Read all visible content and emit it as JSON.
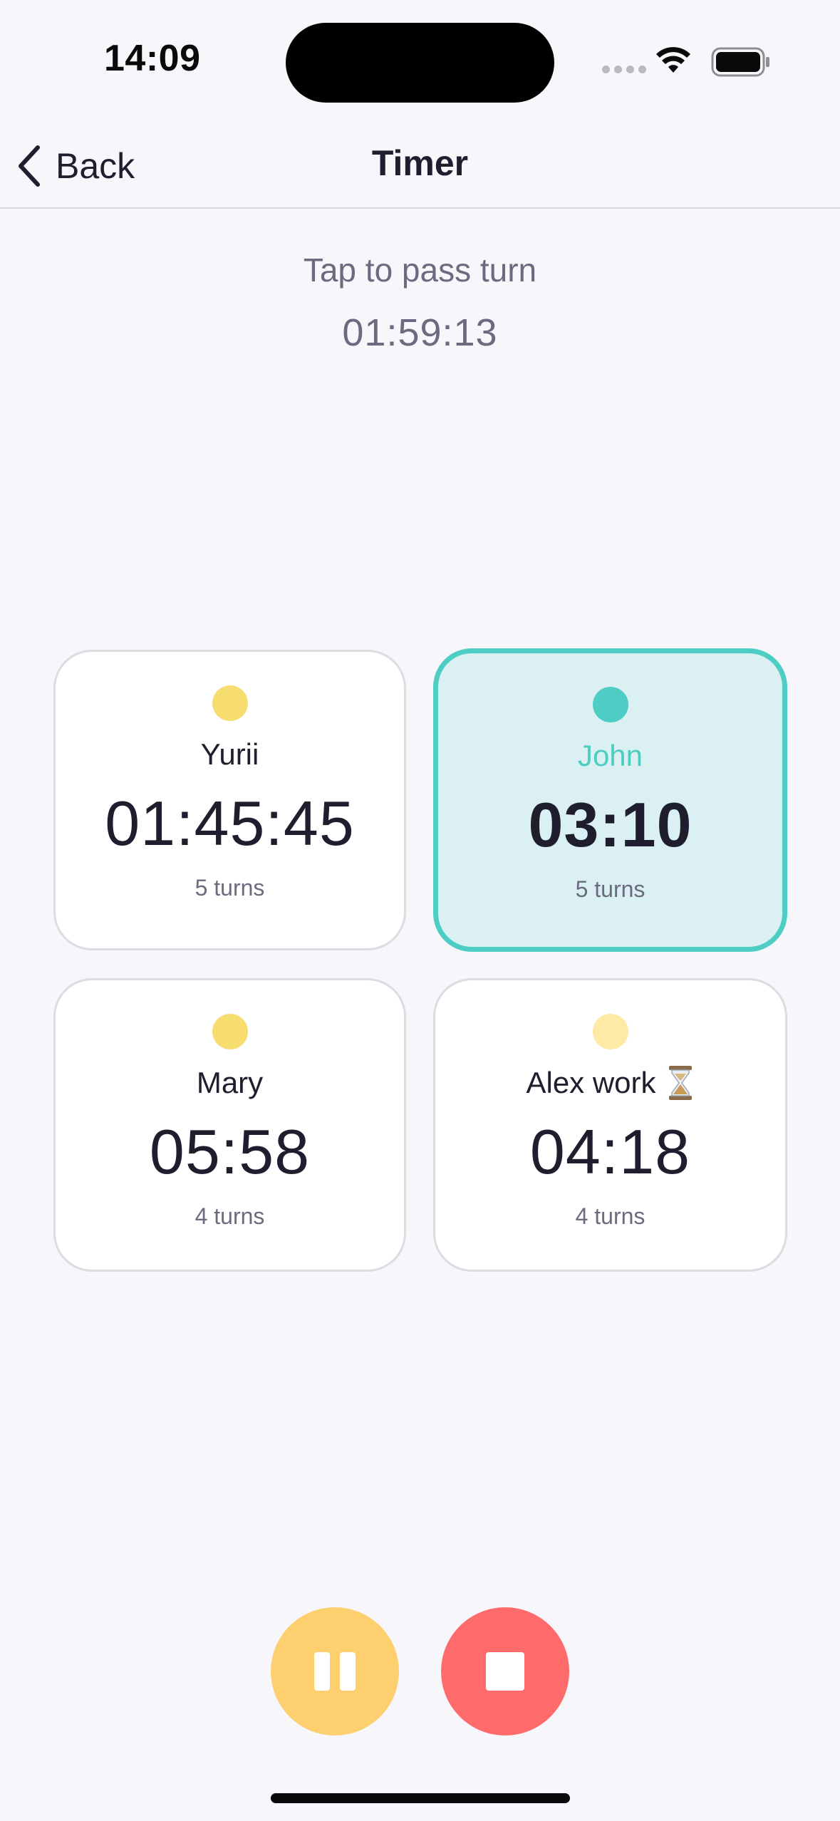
{
  "status_bar": {
    "time": "14:09",
    "icons": [
      "cellular-signal-icon",
      "wifi-icon",
      "battery-icon"
    ]
  },
  "nav": {
    "back_label": "Back",
    "title": "Timer"
  },
  "hint": "Tap to pass turn",
  "total_time": "01:59:13",
  "players": [
    {
      "name": "Yurii",
      "time": "01:45:45",
      "turns": "5 turns",
      "color": "#f7dc6f",
      "active": false
    },
    {
      "name": "John",
      "time": "03:10",
      "turns": "5 turns",
      "color": "#4ecdc4",
      "active": true
    },
    {
      "name": "Mary",
      "time": "05:58",
      "turns": "4 turns",
      "color": "#f7dc6f",
      "active": false
    },
    {
      "name": "Alex work",
      "time": "04:18",
      "turns": "4 turns",
      "color": "#fdeaa4",
      "active": false,
      "status_icon": "hourglass-icon"
    }
  ],
  "controls": {
    "pause_color": "#fdcf6f",
    "stop_color": "#ff6b6b"
  }
}
